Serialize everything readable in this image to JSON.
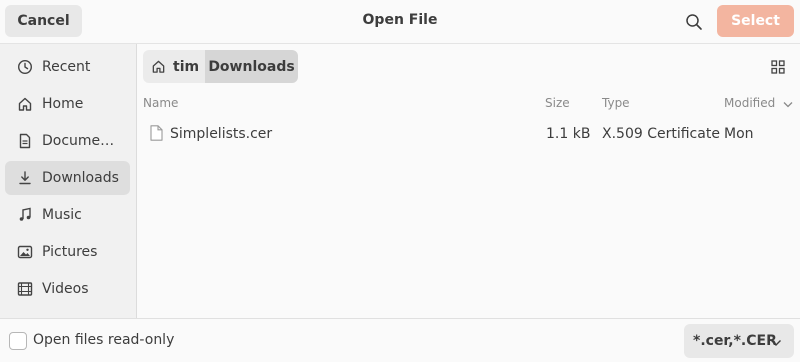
{
  "header": {
    "cancel_label": "Cancel",
    "title": "Open File",
    "select_label": "Select"
  },
  "sidebar": {
    "items": [
      {
        "label": "Recent",
        "icon": "clock-icon"
      },
      {
        "label": "Home",
        "icon": "home-icon"
      },
      {
        "label": "Docume…",
        "icon": "document-icon"
      },
      {
        "label": "Downloads",
        "icon": "download-icon",
        "active": true
      },
      {
        "label": "Music",
        "icon": "music-icon"
      },
      {
        "label": "Pictures",
        "icon": "pictures-icon"
      },
      {
        "label": "Videos",
        "icon": "videos-icon"
      }
    ]
  },
  "breadcrumb": {
    "items": [
      "tim",
      "Downloads"
    ]
  },
  "columns": {
    "name": "Name",
    "size": "Size",
    "type": "Type",
    "modified": "Modified"
  },
  "files": [
    {
      "name": "Simplelists.cer",
      "size": "1.1 kB",
      "type": "X.509 Certificate",
      "modified": "Mon"
    }
  ],
  "footer": {
    "readonly_label": "Open files read-only",
    "filter_label": "*.cer,*.CER"
  },
  "colors": {
    "accent_disabled": "#f3b5a0",
    "sidebar_bg": "#f1f1f1",
    "active_bg": "#dedede"
  }
}
